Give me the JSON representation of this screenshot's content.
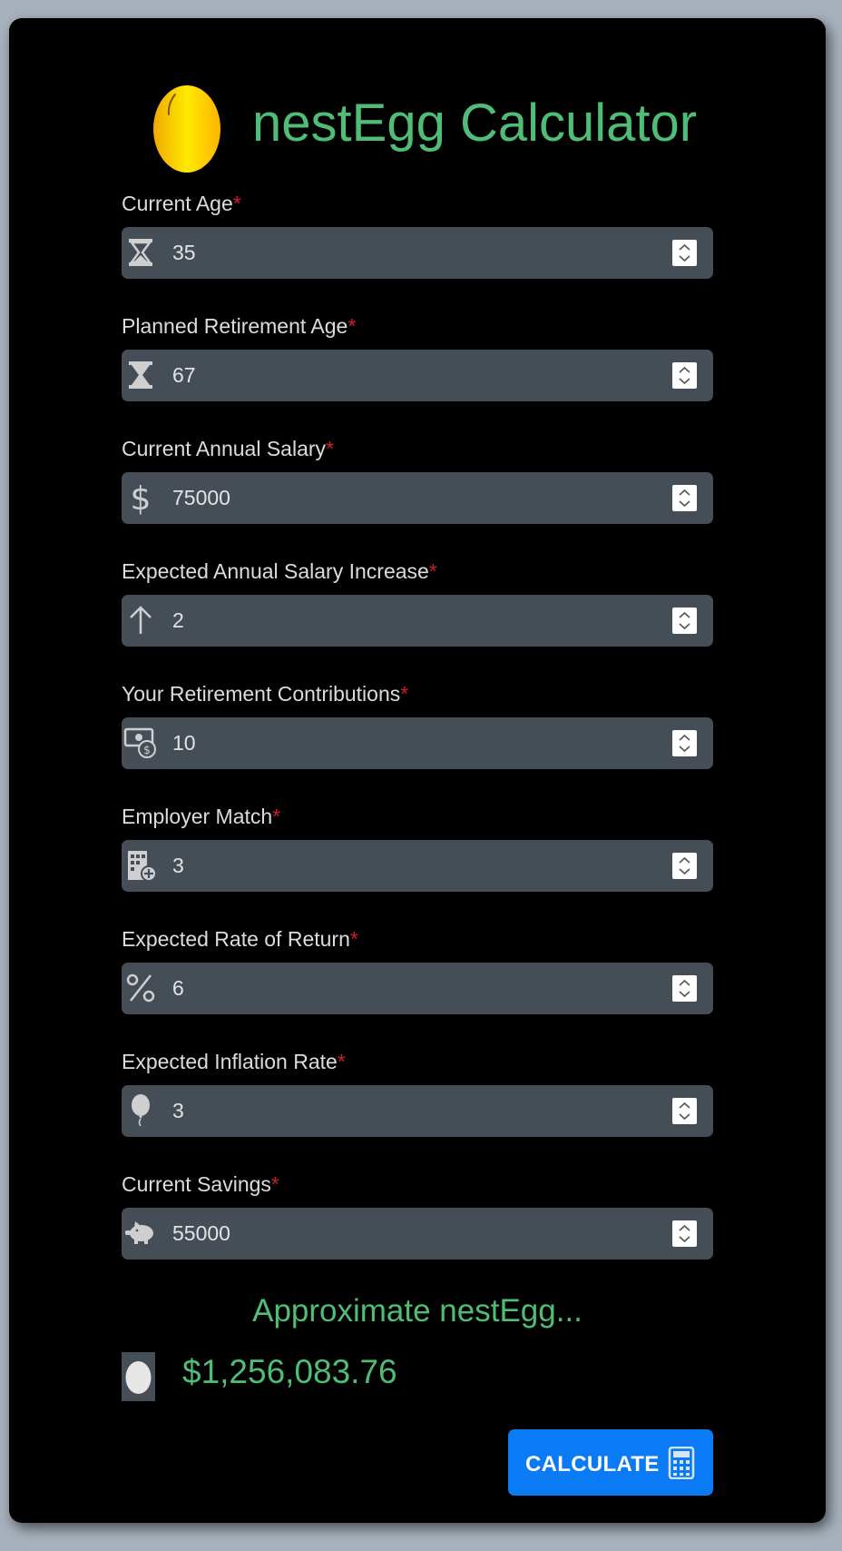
{
  "app": {
    "title": "nestEgg Calculator"
  },
  "form": {
    "required_marker": "*",
    "fields": [
      {
        "label": "Current Age",
        "value": "35",
        "icon": "hourglass-icon"
      },
      {
        "label": "Planned Retirement Age",
        "value": "67",
        "icon": "hourglass-half-icon"
      },
      {
        "label": "Current Annual Salary",
        "value": "75000",
        "icon": "dollar-icon"
      },
      {
        "label": "Expected Annual Salary Increase",
        "value": "2",
        "icon": "arrow-up-icon"
      },
      {
        "label": "Your Retirement Contributions",
        "value": "10",
        "icon": "money-icon"
      },
      {
        "label": "Employer Match",
        "value": "3",
        "icon": "building-plus-icon"
      },
      {
        "label": "Expected Rate of Return",
        "value": "6",
        "icon": "percent-icon"
      },
      {
        "label": "Expected Inflation Rate",
        "value": "3",
        "icon": "balloon-icon"
      },
      {
        "label": "Current Savings",
        "value": "55000",
        "icon": "piggy-bank-icon"
      }
    ]
  },
  "result": {
    "heading": "Approximate nestEgg...",
    "value": "$1,256,083.76"
  },
  "actions": {
    "calculate_label": "CALCULATE"
  },
  "colors": {
    "accent_green": "#4fbd76",
    "button_blue": "#0a7af5",
    "input_background": "#454e57",
    "required_red": "#d51c26",
    "egg_gold": "#ffd200"
  }
}
